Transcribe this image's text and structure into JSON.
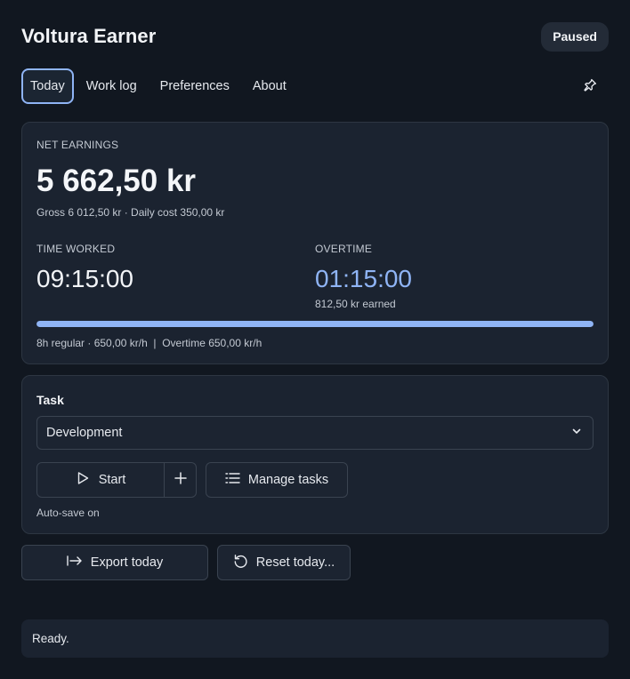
{
  "app": {
    "title": "Voltura Earner",
    "status": "Paused"
  },
  "tabs": [
    {
      "label": "Today",
      "active": true
    },
    {
      "label": "Work log"
    },
    {
      "label": "Preferences"
    },
    {
      "label": "About"
    }
  ],
  "pin_icon": "pin-icon",
  "earnings": {
    "net_label": "NET EARNINGS",
    "net_value": "5 662,50 kr",
    "net_sub": "Gross 6 012,50 kr · Daily cost 350,00 kr",
    "time_worked_label": "TIME WORKED",
    "time_worked_value": "09:15:00",
    "overtime_label": "OVERTIME",
    "overtime_value": "01:15:00",
    "overtime_sub": "812,50 kr earned",
    "progress_fraction": 1.0,
    "rates": "8h regular · 650,00 kr/h  |  Overtime 650,00 kr/h"
  },
  "task": {
    "label": "Task",
    "selected": "Development",
    "start_label": "Start",
    "manage_label": "Manage tasks",
    "autosave": "Auto-save on"
  },
  "actions": {
    "export_label": "Export today",
    "reset_label": "Reset today..."
  },
  "status_bar": {
    "message": "Ready."
  },
  "colors": {
    "accent": "#8fb4f5",
    "background": "#111720",
    "card": "#1b2330"
  }
}
